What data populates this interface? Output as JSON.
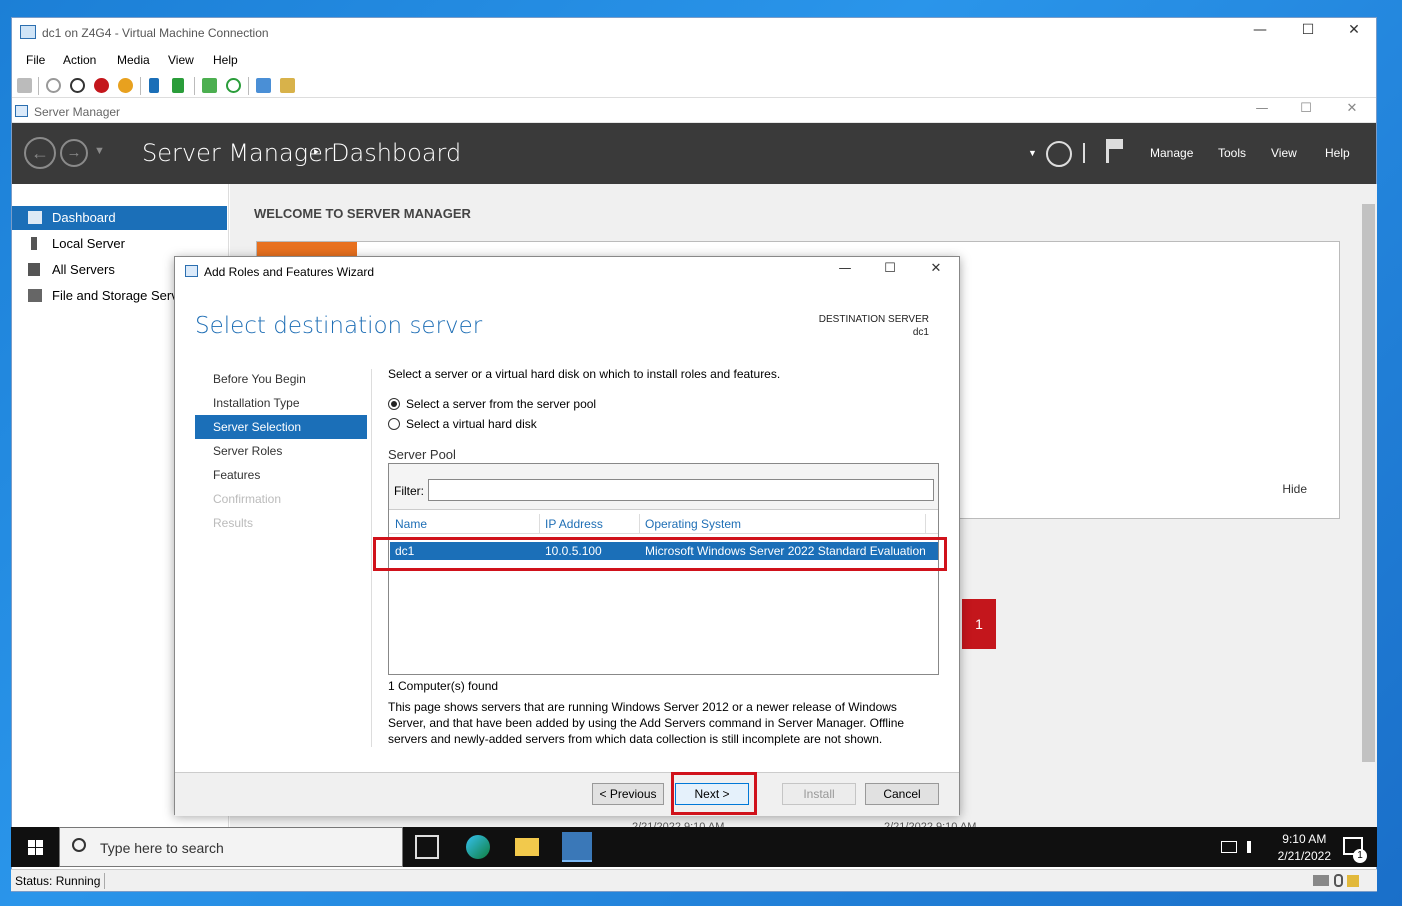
{
  "vm": {
    "title": "dc1 on Z4G4 - Virtual Machine Connection",
    "menu": [
      "File",
      "Action",
      "Media",
      "View",
      "Help"
    ],
    "controls": {
      "minimize": "—",
      "maximize": "☐",
      "close": "✕"
    },
    "status": "Status: Running"
  },
  "server_manager": {
    "window_title": "Server Manager",
    "breadcrumb_root": "Server Manager",
    "breadcrumb_sep": "‣",
    "breadcrumb_page": "Dashboard",
    "header_menu": [
      "Manage",
      "Tools",
      "View",
      "Help"
    ],
    "sidebar": [
      {
        "label": "Dashboard",
        "active": true
      },
      {
        "label": "Local Server",
        "active": false
      },
      {
        "label": "All Servers",
        "active": false
      },
      {
        "label": "File and Storage Services",
        "active": false
      }
    ],
    "welcome": "WELCOME TO SERVER MANAGER",
    "hide": "Hide",
    "tile_count": "1",
    "dates": [
      "2/21/2022 9:10 AM",
      "2/21/2022 9:10 AM"
    ]
  },
  "wizard": {
    "title": "Add Roles and Features Wizard",
    "heading": "Select destination server",
    "dest_label": "DESTINATION SERVER",
    "dest_value": "dc1",
    "steps": [
      {
        "label": "Before You Begin",
        "state": "normal"
      },
      {
        "label": "Installation Type",
        "state": "normal"
      },
      {
        "label": "Server Selection",
        "state": "active"
      },
      {
        "label": "Server Roles",
        "state": "normal"
      },
      {
        "label": "Features",
        "state": "normal"
      },
      {
        "label": "Confirmation",
        "state": "dim"
      },
      {
        "label": "Results",
        "state": "dim"
      }
    ],
    "intro": "Select a server or a virtual hard disk on which to install roles and features.",
    "radio_pool": "Select a server from the server pool",
    "radio_vhd": "Select a virtual hard disk",
    "pool_label": "Server Pool",
    "filter_label": "Filter:",
    "filter_value": "",
    "columns": [
      "Name",
      "IP Address",
      "Operating System"
    ],
    "rows": [
      {
        "name": "dc1",
        "ip": "10.0.5.100",
        "os": "Microsoft Windows Server 2022 Standard Evaluation"
      }
    ],
    "found": "1 Computer(s) found",
    "note": "This page shows servers that are running Windows Server 2012 or a newer release of Windows Server, and that have been added by using the Add Servers command in Server Manager. Offline servers and newly-added servers from which data collection is still incomplete are not shown.",
    "buttons": {
      "previous": "< Previous",
      "next": "Next >",
      "install": "Install",
      "cancel": "Cancel"
    }
  },
  "taskbar": {
    "search_placeholder": "Type here to search",
    "time": "9:10 AM",
    "date": "2/21/2022",
    "notification_count": "1"
  }
}
